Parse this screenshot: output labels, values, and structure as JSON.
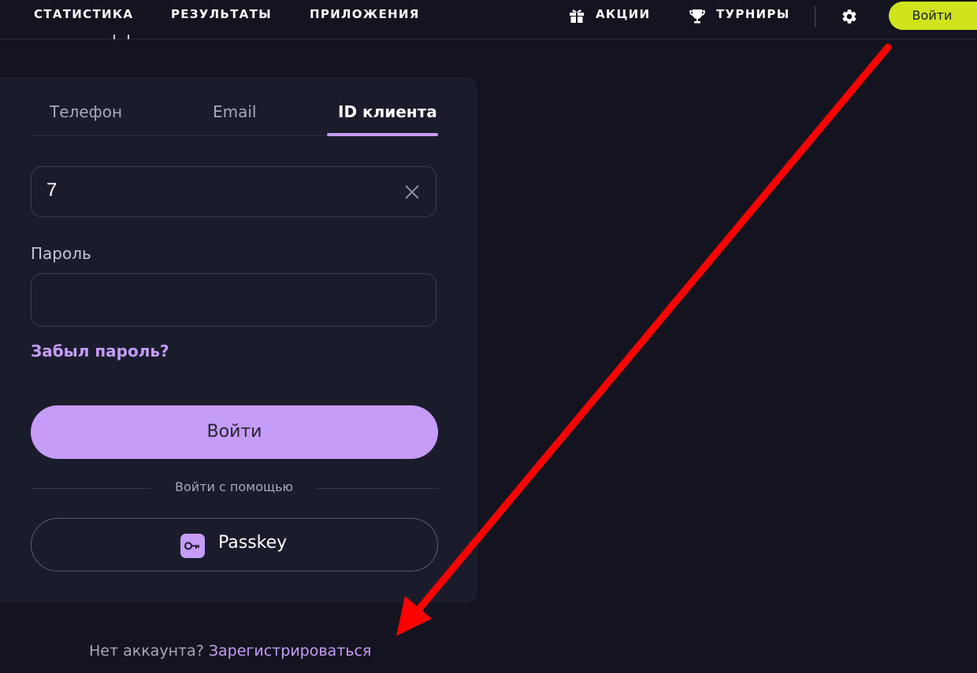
{
  "nav": {
    "links": [
      "СТАТИСТИКА",
      "РЕЗУЛЬТАТЫ",
      "ПРИЛОЖЕНИЯ"
    ],
    "promo_label": "АКЦИИ",
    "promo_icon": "gift-icon",
    "tournaments_label": "ТУРНИРЫ",
    "tournaments_icon": "trophy-icon",
    "settings_icon": "gear-icon",
    "login_label": "Войти",
    "login_color": "#cfe41d"
  },
  "form": {
    "tabs": [
      "Телефон",
      "Email",
      "ID клиента"
    ],
    "active_tab": "ID клиента",
    "client_id_value": "7",
    "clear_icon": "close-icon",
    "password_label": "Пароль",
    "password_value": "",
    "forgot_password": "Забыл пароль?",
    "submit_label": "Войти",
    "separator_text": "Войти с помощью",
    "passkey_label": "Passkey",
    "passkey_icon": "key-icon",
    "accent_color": "#c59cf8"
  },
  "footer": {
    "no_account_text": "Нет аккаунта?",
    "register_link": "Зарегистрироваться"
  },
  "annotation": {
    "arrow_color": "#ff0000"
  }
}
